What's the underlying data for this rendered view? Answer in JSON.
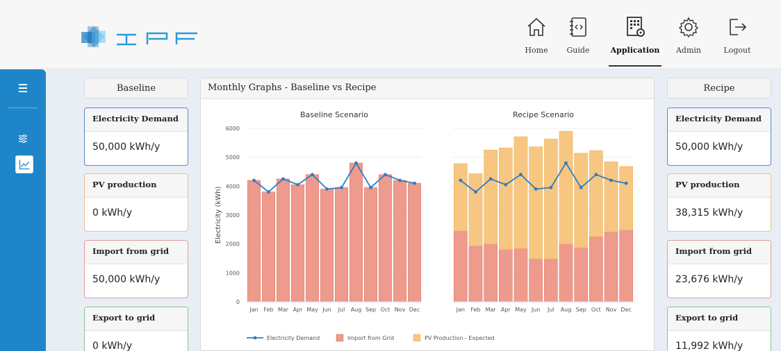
{
  "header": {
    "nav": [
      {
        "label": "Home",
        "icon": "home-icon"
      },
      {
        "label": "Guide",
        "icon": "guide-icon"
      },
      {
        "label": "Application",
        "icon": "application-icon",
        "active": true
      },
      {
        "label": "Admin",
        "icon": "gear-icon"
      },
      {
        "label": "Logout",
        "icon": "logout-icon"
      }
    ]
  },
  "colors": {
    "sidebar": "#1e86c8",
    "import": "#ee9a8d",
    "pv": "#f7c680",
    "demand": "#2f7dbf"
  },
  "baseline": {
    "title": "Baseline",
    "cards": [
      {
        "title": "Electricity Demand",
        "value": "50,000 kWh/y"
      },
      {
        "title": "PV production",
        "value": "0 kWh/y"
      },
      {
        "title": "Import from grid",
        "value": "50,000 kWh/y"
      },
      {
        "title": "Export to grid",
        "value": "0 kWh/y"
      }
    ]
  },
  "recipe": {
    "title": "Recipe",
    "cards": [
      {
        "title": "Electricity Demand",
        "value": "50,000 kWh/y"
      },
      {
        "title": "PV production",
        "value": "38,315 kWh/y"
      },
      {
        "title": "Import from grid",
        "value": "23,676 kWh/y"
      },
      {
        "title": "Export to grid",
        "value": "11,992 kWh/y"
      }
    ]
  },
  "panel": {
    "title": "Monthly Graphs - Baseline vs Recipe"
  },
  "chart_data": [
    {
      "type": "bar",
      "title": "Baseline Scenario",
      "ylabel": "Electricity (kWh)",
      "ylim": [
        0,
        6000
      ],
      "yticks": [
        0,
        1000,
        2000,
        3000,
        4000,
        5000,
        6000
      ],
      "categories": [
        "Jan",
        "Feb",
        "Mar",
        "Apr",
        "May",
        "Jun",
        "Jul",
        "Aug",
        "Sep",
        "Oct",
        "Nov",
        "Dec"
      ],
      "series": [
        {
          "name": "Import from Grid",
          "kind": "bar",
          "values": [
            4200,
            3800,
            4250,
            4050,
            4400,
            3900,
            3950,
            4800,
            3950,
            4400,
            4200,
            4100
          ]
        },
        {
          "name": "Electricity Demand",
          "kind": "line",
          "values": [
            4200,
            3800,
            4250,
            4050,
            4400,
            3900,
            3950,
            4800,
            3950,
            4400,
            4200,
            4100
          ]
        }
      ]
    },
    {
      "type": "bar",
      "title": "Recipe Scenario",
      "ylim": [
        0,
        6000
      ],
      "categories": [
        "Jan",
        "Feb",
        "Mar",
        "Apr",
        "May",
        "Jun",
        "Jul",
        "Aug",
        "Sep",
        "Oct",
        "Nov",
        "Dec"
      ],
      "series": [
        {
          "name": "Import from Grid",
          "kind": "bar",
          "stacked": true,
          "values": [
            2450,
            1930,
            2000,
            1800,
            1840,
            1480,
            1480,
            2000,
            1870,
            2250,
            2420,
            2480
          ]
        },
        {
          "name": "PV Production - Expected",
          "kind": "bar",
          "stacked": true,
          "values": [
            2330,
            2500,
            3250,
            3520,
            3870,
            3880,
            4150,
            3900,
            3270,
            2980,
            2420,
            2200
          ]
        },
        {
          "name": "Electricity Demand",
          "kind": "line",
          "values": [
            4200,
            3800,
            4250,
            4050,
            4400,
            3900,
            3950,
            4800,
            3950,
            4400,
            4200,
            4100
          ]
        }
      ]
    }
  ],
  "legend": [
    "Electricity Demand",
    "Import from Grid",
    "PV Production - Expected"
  ]
}
